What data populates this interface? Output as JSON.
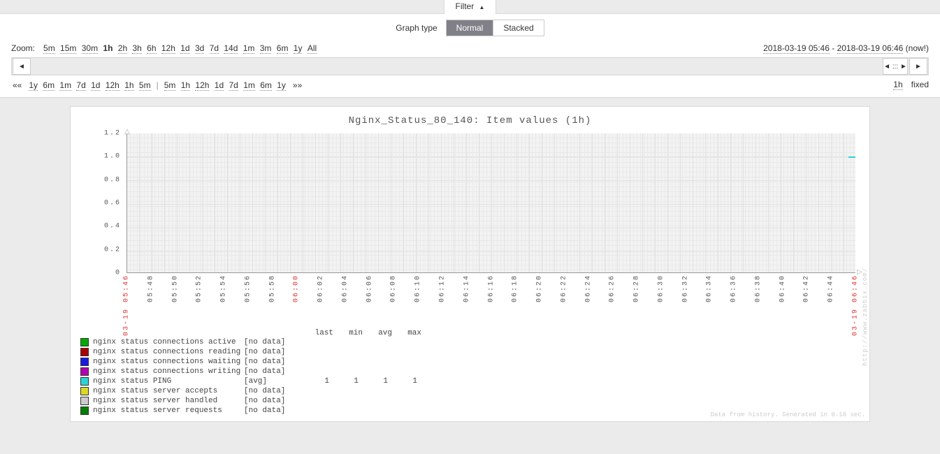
{
  "filter_tab": "Filter",
  "graphtype_label": "Graph type",
  "graphtype": {
    "normal": "Normal",
    "stacked": "Stacked",
    "active": "normal"
  },
  "zoom_label": "Zoom:",
  "zoom_options": [
    "5m",
    "15m",
    "30m",
    "1h",
    "2h",
    "3h",
    "6h",
    "12h",
    "1d",
    "3d",
    "7d",
    "14d",
    "1m",
    "3m",
    "6m",
    "1y",
    "All"
  ],
  "zoom_active": "1h",
  "time_from": "2018-03-19 05:46",
  "time_to": "2018-03-19 06:46",
  "time_now": "(now!)",
  "shift_dbl_left": "««",
  "shift_dbl_right": "»»",
  "shift_back": [
    "1y",
    "6m",
    "1m",
    "7d",
    "1d",
    "12h",
    "1h",
    "5m"
  ],
  "shift_sep": "|",
  "shift_fwd": [
    "5m",
    "1h",
    "12h",
    "1d",
    "7d",
    "1m",
    "6m",
    "1y"
  ],
  "fixed_label": "fixed",
  "fixed_range": "1h",
  "chart_data": {
    "type": "line",
    "title": "Nginx_Status_80_140: Item values (1h)",
    "ylim": [
      0,
      1.2
    ],
    "yticks": [
      0,
      0.2,
      0.4,
      0.6,
      0.8,
      1.0,
      1.2
    ],
    "x_start": "03-19 05:46",
    "x_end": "03-19 06:46",
    "xticks": [
      "05:48",
      "05:50",
      "05:52",
      "05:54",
      "05:56",
      "05:58",
      "06:00",
      "06:02",
      "06:04",
      "06:06",
      "06:08",
      "06:10",
      "06:12",
      "06:14",
      "06:16",
      "06:18",
      "06:20",
      "06:22",
      "06:24",
      "06:26",
      "06:28",
      "06:30",
      "06:32",
      "06:34",
      "06:36",
      "06:38",
      "06:40",
      "06:42",
      "06:44"
    ],
    "xticks_red": [
      "06:00"
    ],
    "series": [
      {
        "name": "nginx status connections active",
        "color": "#00aa00",
        "agg": "[no data]"
      },
      {
        "name": "nginx status connections reading",
        "color": "#aa0000",
        "agg": "[no data]"
      },
      {
        "name": "nginx status connections waiting",
        "color": "#1a1ae6",
        "agg": "[no data]"
      },
      {
        "name": "nginx status connections writing",
        "color": "#b300b3",
        "agg": "[no data]"
      },
      {
        "name": "nginx status PING",
        "color": "#2dd4d4",
        "agg": "[avg]",
        "last": 1,
        "min": 1,
        "avg": 1,
        "max": 1
      },
      {
        "name": "nginx status server accepts",
        "color": "#d9d926",
        "agg": "[no data]"
      },
      {
        "name": "nginx status server handled",
        "color": "#cccccc",
        "agg": "[no data]"
      },
      {
        "name": "nginx status server requests",
        "color": "#008000",
        "agg": "[no data]"
      }
    ],
    "legend_headers": [
      "last",
      "min",
      "avg",
      "max"
    ]
  },
  "footer": "Data from history. Generated in 0.18 sec.",
  "watermark": "http://www.zabbix.com/"
}
